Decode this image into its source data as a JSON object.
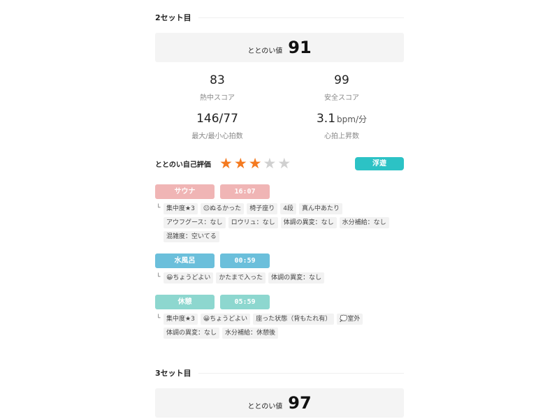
{
  "set2": {
    "title": "2セット目",
    "totonoi_label": "ととのい値",
    "totonoi_value": "91",
    "stats": [
      {
        "value": "83",
        "unit": "",
        "label": "熱中スコア"
      },
      {
        "value": "99",
        "unit": "",
        "label": "安全スコア"
      },
      {
        "value": "146/77",
        "unit": "",
        "label": "最大/最小心拍数"
      },
      {
        "value": "3.1",
        "unit": "bpm/分",
        "label": "心拍上昇数"
      }
    ],
    "rating_label": "ととのい自己評価",
    "rating_stars": 3,
    "rating_max": 5,
    "mood": "浮遊",
    "activities": [
      {
        "name": "サウナ",
        "time": "16:07",
        "color": "#f0b5b5",
        "tags": [
          "集中度★3",
          "😐ぬるかった",
          "椅子座り",
          "4段",
          "真ん中あたり",
          "アウフグース：なし",
          "ロウリュ：なし",
          "体調の異変：なし",
          "水分補給：なし",
          "混雑度：空いてる"
        ]
      },
      {
        "name": "水風呂",
        "time": "00:59",
        "color": "#6bbfdb",
        "tags": [
          "😀ちょうどよい",
          "かたまで入った",
          "体調の異変：なし"
        ]
      },
      {
        "name": "休憩",
        "time": "05:59",
        "color": "#8dd7cf",
        "tags": [
          "集中度★3",
          "😀ちょうどよい",
          "座った状態（背もたれ有）",
          "💭室外",
          "体調の異変：なし",
          "水分補給：休憩後"
        ]
      }
    ]
  },
  "set3": {
    "title": "3セット目",
    "totonoi_label": "ととのい値",
    "totonoi_value": "97"
  },
  "icons": {
    "star": "star-icon",
    "branch": "branch-icon"
  }
}
